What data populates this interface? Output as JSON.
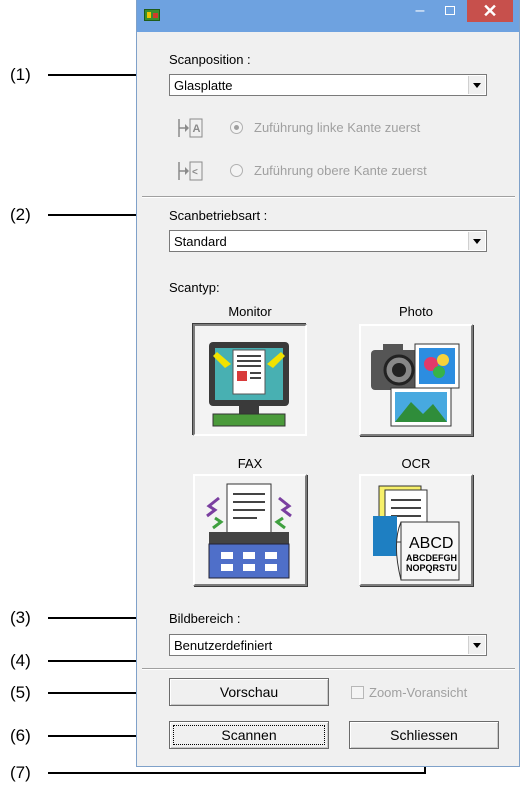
{
  "callouts": [
    {
      "label": "(1)"
    },
    {
      "label": "(2)"
    },
    {
      "label": "(3)"
    },
    {
      "label": "(4)"
    },
    {
      "label": "(5)"
    },
    {
      "label": "(6)"
    },
    {
      "label": "(7)"
    }
  ],
  "titlebar": {
    "minimize_glyph": "–",
    "close_glyph": "✕"
  },
  "scan_position": {
    "label": "Scanposition :",
    "value": "Glasplatte",
    "feed_left_label": "Zuführung linke Kante zuerst",
    "feed_top_label": "Zuführung obere Kante zuerst"
  },
  "scan_mode": {
    "label": "Scanbetriebsart :",
    "value": "Standard"
  },
  "scan_type": {
    "label": "Scantyp:",
    "buttons": [
      {
        "label": "Monitor",
        "icon": "monitor-icon"
      },
      {
        "label": "Photo",
        "icon": "camera-photo-icon"
      },
      {
        "label": "FAX",
        "icon": "fax-icon"
      },
      {
        "label": "OCR",
        "icon": "ocr-document-icon"
      }
    ],
    "ocr_text_1": "ABCD",
    "ocr_text_2": "ABCDEFGH",
    "ocr_text_3": "NOPQRSTU"
  },
  "image_area": {
    "label": "Bildbereich :",
    "value": "Benutzerdefiniert"
  },
  "buttons": {
    "preview": "Vorschau",
    "zoom_preview": "Zoom-Voransicht",
    "scan": "Scannen",
    "close": "Schliessen"
  },
  "colors": {
    "titlebar": "#6ea2e0",
    "close_button": "#c7504c",
    "window_bg": "#f0f0f0"
  }
}
